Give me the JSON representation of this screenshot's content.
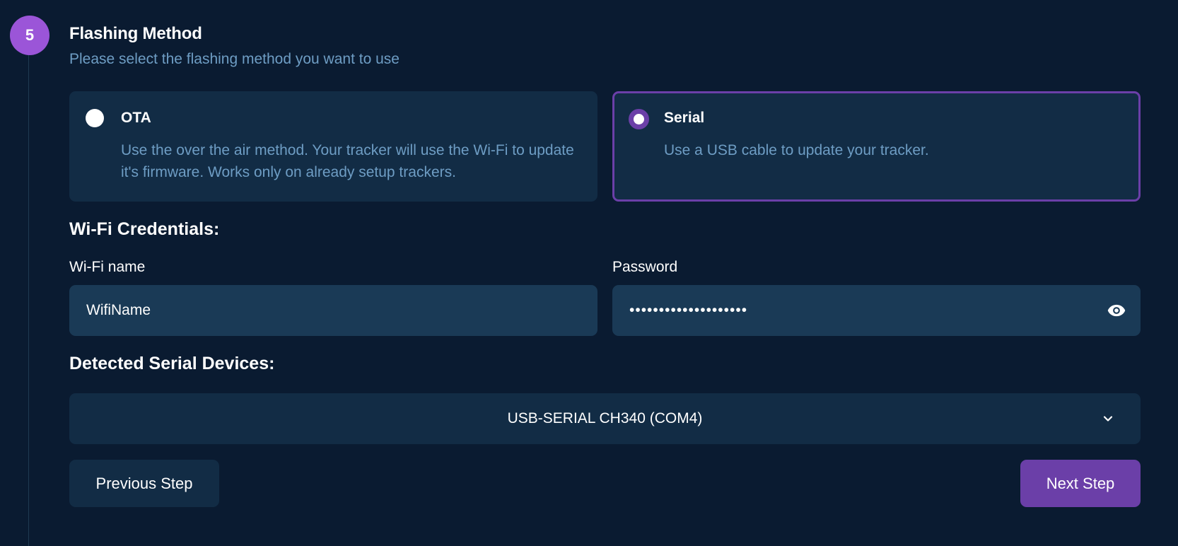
{
  "step": {
    "number": "5",
    "title": "Flashing Method",
    "subtitle": "Please select the flashing method you want to use"
  },
  "methods": [
    {
      "label": "OTA",
      "description": "Use the over the air method. Your tracker will use the Wi-Fi to update it's firmware. Works only on already setup trackers.",
      "selected": false
    },
    {
      "label": "Serial",
      "description": "Use a USB cable to update your tracker.",
      "selected": true
    }
  ],
  "wifi": {
    "section_title": "Wi-Fi Credentials:",
    "name_label": "Wi-Fi name",
    "name_value": "WifiName",
    "password_label": "Password",
    "password_masked": "••••••••••••••••••••"
  },
  "serial_devices": {
    "section_title": "Detected Serial Devices:",
    "selected": "USB-SERIAL CH340 (COM4)"
  },
  "buttons": {
    "previous": "Previous Step",
    "next": "Next Step"
  },
  "colors": {
    "background": "#0a1b31",
    "card": "#122c45",
    "input": "#1a3a56",
    "accent": "#6b3fa8",
    "badge": "#9b55d8",
    "muted_text": "#6e9dc4"
  },
  "icons": {
    "password_toggle": "eye-icon",
    "dropdown": "chevron-down-icon"
  }
}
